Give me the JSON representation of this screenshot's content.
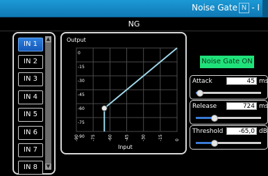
{
  "titlebar": {
    "title": "Noise Gate",
    "n_glyph": "N",
    "tail": "- I"
  },
  "header": {
    "label": "NG"
  },
  "inputs": [
    "IN 1",
    "IN 2",
    "IN 3",
    "IN 4",
    "IN 5",
    "IN 6",
    "IN 7",
    "IN 8"
  ],
  "active_input": "IN 1",
  "graph": {
    "output_label": "Output",
    "input_label": "Input",
    "y_ticks": [
      "0",
      "-15",
      "-30",
      "-45",
      "-60",
      "-75",
      "-90"
    ],
    "x_ticks": [
      "-90",
      "-75",
      "-60",
      "-45",
      "-30",
      "-15",
      "0"
    ]
  },
  "chart_data": {
    "type": "line",
    "xlim": [
      -90,
      0
    ],
    "ylim": [
      -90,
      0
    ],
    "xlabel": "Input",
    "ylabel": "Output",
    "series": [
      {
        "x": [
          -65,
          -65,
          0
        ],
        "y": [
          -90,
          -65,
          0
        ]
      }
    ],
    "handle": {
      "x": -65,
      "y": -65
    }
  },
  "gate_button": {
    "label": "Noise Gate ON",
    "color": "#20e27a"
  },
  "params": {
    "attack": {
      "label": "Attack",
      "value": "45",
      "unit": "ms",
      "level": 0.05
    },
    "release": {
      "label": "Release",
      "value": "724",
      "unit": "ms",
      "level": 0.28
    },
    "threshold": {
      "label": "Threshold",
      "value": "-65,0",
      "unit": "dBu",
      "level": 0.28
    }
  }
}
